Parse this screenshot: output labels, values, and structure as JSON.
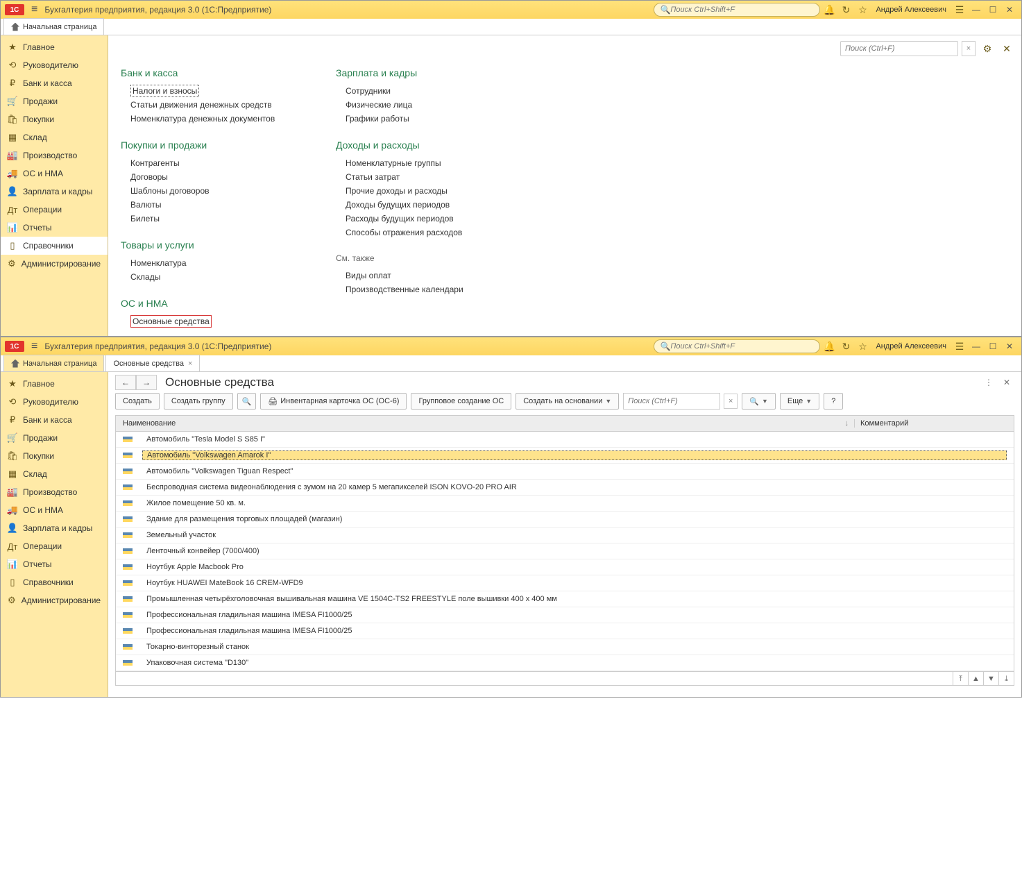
{
  "app": {
    "title": "Бухгалтерия предприятия, редакция 3.0  (1С:Предприятие)",
    "search_placeholder": "Поиск Ctrl+Shift+F",
    "user": "Андрей Алексеевич"
  },
  "tabs": {
    "home": "Начальная страница",
    "tab2": "Основные средства"
  },
  "sidebar": [
    {
      "icon": "★",
      "label": "Главное"
    },
    {
      "icon": "⟲",
      "label": "Руководителю"
    },
    {
      "icon": "₽",
      "label": "Банк и касса"
    },
    {
      "icon": "🛒",
      "label": "Продажи"
    },
    {
      "icon": "🛍",
      "label": "Покупки"
    },
    {
      "icon": "▦",
      "label": "Склад"
    },
    {
      "icon": "🏭",
      "label": "Производство"
    },
    {
      "icon": "🚚",
      "label": "ОС и НМА"
    },
    {
      "icon": "👤",
      "label": "Зарплата и кадры"
    },
    {
      "icon": "Дт",
      "label": "Операции"
    },
    {
      "icon": "📊",
      "label": "Отчеты"
    },
    {
      "icon": "▯",
      "label": "Справочники"
    },
    {
      "icon": "⚙",
      "label": "Администрирование"
    }
  ],
  "win1": {
    "search_placeholder": "Поиск (Ctrl+F)",
    "sections": {
      "bank": {
        "title": "Банк и касса",
        "links": [
          "Налоги и взносы",
          "Статьи движения денежных средств",
          "Номенклатура денежных документов"
        ]
      },
      "salary": {
        "title": "Зарплата и кадры",
        "links": [
          "Сотрудники",
          "Физические лица",
          "Графики работы"
        ]
      },
      "purchases": {
        "title": "Покупки и продажи",
        "links": [
          "Контрагенты",
          "Договоры",
          "Шаблоны договоров",
          "Валюты",
          "Билеты"
        ]
      },
      "income": {
        "title": "Доходы и расходы",
        "links": [
          "Номенклатурные группы",
          "Статьи затрат",
          "Прочие доходы и расходы",
          "Доходы будущих периодов",
          "Расходы будущих периодов",
          "Способы отражения расходов"
        ]
      },
      "goods": {
        "title": "Товары и услуги",
        "links": [
          "Номенклатура",
          "Склады"
        ]
      },
      "see_also": "См. также",
      "see_also_links": [
        "Виды оплат",
        "Производственные календари"
      ],
      "os": {
        "title": "ОС и НМА",
        "link": "Основные средства"
      }
    }
  },
  "win2": {
    "page_title": "Основные средства",
    "buttons": {
      "create": "Создать",
      "create_group": "Создать группу",
      "print_card": "Инвентарная карточка ОС (ОС-6)",
      "group_create": "Групповое создание ОС",
      "create_based": "Создать на основании",
      "more": "Еще",
      "search_placeholder": "Поиск (Ctrl+F)"
    },
    "columns": {
      "name": "Наименование",
      "comment": "Комментарий"
    },
    "rows": [
      "Автомобиль \"Tesla Model S S85 I\"",
      "Автомобиль \"Volkswagen Amarok I\"",
      "Автомобиль \"Volkswagen Tiguan Respect\"",
      "Беспроводная система видеонаблюдения с зумом на 20 камер 5 мегапикселей ISON KOVO-20 PRO AIR",
      "Жилое помещение 50 кв. м.",
      "Здание для размещения торговых площадей (магазин)",
      "Земельный участок",
      "Ленточный конвейер (7000/400)",
      "Ноутбук Apple Macbook Pro",
      "Ноутбук HUAWEI MateBook 16 CREM-WFD9",
      "Промышленная четырёхголовочная вышивальная машина VE 1504C-TS2 FREESTYLE поле вышивки 400 х 400 мм",
      "Профессиональная гладильная машина IMESA FI1000/25",
      "Профессиональная гладильная машина IMESA FI1000/25",
      "Токарно-винторезный станок",
      "Упаковочная система \"D130\""
    ],
    "selected_index": 1
  }
}
